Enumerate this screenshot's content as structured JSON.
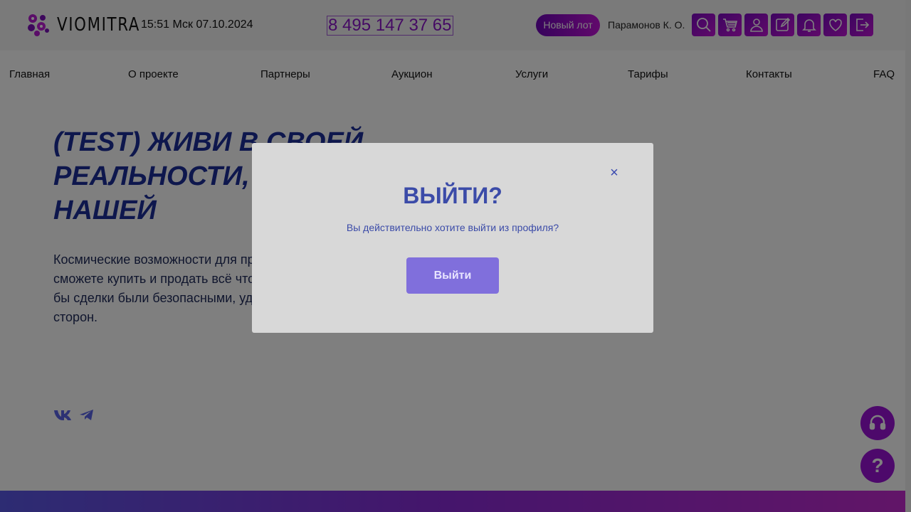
{
  "header": {
    "logo_text": "VIOMITRA",
    "clock": "15:51 Мск 07.10.2024",
    "phone": "8 495 147 37 65",
    "new_lot_label": "Новый лот",
    "user_name": "Парамонов К. О.",
    "icons": [
      "search-icon",
      "cart-icon",
      "user-icon",
      "edit-icon",
      "bell-icon",
      "heart-icon",
      "logout-icon"
    ]
  },
  "nav": {
    "items": [
      "Главная",
      "О проекте",
      "Партнеры",
      "Аукцион",
      "Услуги",
      "Тарифы",
      "Контакты",
      "FAQ"
    ]
  },
  "hero": {
    "title": "(Test) ЖИВИ В СВОЕЙ РЕАЛЬНОСТИ, ПРОДАВАЙ - В НАШЕЙ",
    "text": "Космические возможности для проведения любых аукционов. Вы сможете купить и продать всё что угодно. А мы сделаем всё, что бы сделки были безопасными, удобными и выгодными для всех сторон."
  },
  "modal": {
    "close": "×",
    "title": "ВЫЙТИ?",
    "text": "Вы действительно хотите выйти из профиля?",
    "button": "Выйти"
  },
  "floating": {
    "help": "?"
  },
  "colors": {
    "accent": "#9b12d6",
    "title": "#1d2f9a",
    "modal_text": "#3b4ba8",
    "modal_button": "#806fdc"
  }
}
